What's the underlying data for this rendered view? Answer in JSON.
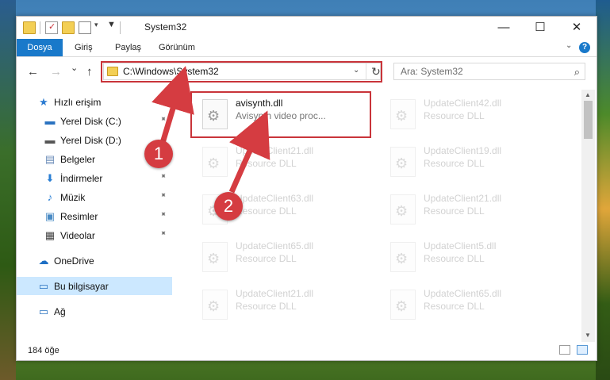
{
  "window": {
    "title": "System32",
    "minimize_glyph": "—",
    "maximize_glyph": "☐",
    "close_glyph": "✕"
  },
  "ribbon": {
    "tabs": [
      "Dosya",
      "Giriş",
      "Paylaş",
      "Görünüm"
    ],
    "help_glyph": "?"
  },
  "nav": {
    "address": "C:\\Windows\\System32",
    "search_placeholder": "Ara: System32",
    "back_glyph": "←",
    "forward_glyph": "→",
    "recent_glyph": "⌄",
    "up_glyph": "↑",
    "dropdown_glyph": "⌄",
    "refresh_glyph": "↻",
    "search_glyph": "⌕"
  },
  "sidebar": {
    "items": [
      {
        "label": "Hızlı erişim",
        "icon": "star-icon",
        "glyph": "★",
        "color": "#2b7bd1"
      },
      {
        "label": "Yerel Disk (C:)",
        "icon": "drive-icon",
        "glyph": "▬",
        "color": "#2a72c0"
      },
      {
        "label": "Yerel Disk (D:)",
        "icon": "drive-icon",
        "glyph": "▬",
        "color": "#555555"
      },
      {
        "label": "Belgeler",
        "icon": "documents-icon",
        "glyph": "▤",
        "color": "#6b8cb8"
      },
      {
        "label": "İndirmeler",
        "icon": "download-icon",
        "glyph": "⬇",
        "color": "#2a7fd4"
      },
      {
        "label": "Müzik",
        "icon": "music-icon",
        "glyph": "♪",
        "color": "#2a7fd4"
      },
      {
        "label": "Resimler",
        "icon": "pictures-icon",
        "glyph": "▣",
        "color": "#4b8bc4"
      },
      {
        "label": "Videolar",
        "icon": "videos-icon",
        "glyph": "▦",
        "color": "#444444"
      },
      {
        "label": "OneDrive",
        "icon": "cloud-icon",
        "glyph": "☁",
        "color": "#1e6fc4"
      },
      {
        "label": "Bu bilgisayar",
        "icon": "computer-icon",
        "glyph": "▭",
        "color": "#2a72c0"
      },
      {
        "label": "Ağ",
        "icon": "network-icon",
        "glyph": "▭",
        "color": "#2a72c0"
      }
    ],
    "pin_glyph": "📌"
  },
  "files": [
    {
      "name": "avisynth.dll",
      "desc": "Avisynth video proc..."
    },
    {
      "name": "UpdateClient42.dll",
      "desc": "Resource DLL"
    },
    {
      "name": "UpdateClient21.dll",
      "desc": "Resource DLL"
    },
    {
      "name": "UpdateClient19.dll",
      "desc": "Resource DLL"
    },
    {
      "name": "UpdateClient63.dll",
      "desc": "Resource DLL"
    },
    {
      "name": "UpdateClient21.dll",
      "desc": "Resource DLL"
    },
    {
      "name": "UpdateClient65.dll",
      "desc": "Resource DLL"
    },
    {
      "name": "UpdateClient5.dll",
      "desc": "Resource DLL"
    },
    {
      "name": "UpdateClient21.dll",
      "desc": "Resource DLL"
    },
    {
      "name": "UpdateClient65.dll",
      "desc": "Resource DLL"
    }
  ],
  "status": {
    "count": "184 öğe"
  },
  "annotations": {
    "marker1": "1",
    "marker2": "2",
    "color": "#d53c41"
  }
}
